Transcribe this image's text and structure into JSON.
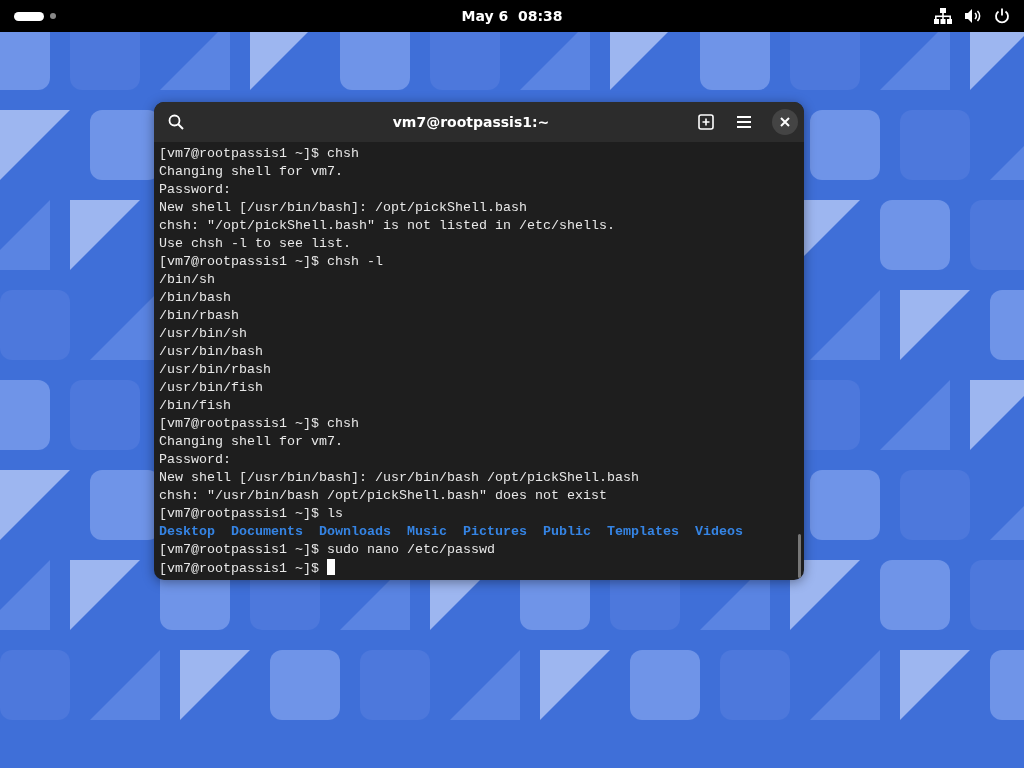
{
  "top_bar": {
    "workspaces": [
      {
        "selected": true
      },
      {
        "selected": false
      }
    ],
    "clock": "May 6  08:38"
  },
  "terminal": {
    "title": "vm7@rootpassis1:~",
    "lines": [
      {
        "kind": "text",
        "text": "[vm7@rootpassis1 ~]$ chsh"
      },
      {
        "kind": "text",
        "text": "Changing shell for vm7."
      },
      {
        "kind": "text",
        "text": "Password:"
      },
      {
        "kind": "text",
        "text": "New shell [/usr/bin/bash]: /opt/pickShell.bash"
      },
      {
        "kind": "text",
        "text": "chsh: \"/opt/pickShell.bash\" is not listed in /etc/shells."
      },
      {
        "kind": "text",
        "text": "Use chsh -l to see list."
      },
      {
        "kind": "text",
        "text": "[vm7@rootpassis1 ~]$ chsh -l"
      },
      {
        "kind": "text",
        "text": "/bin/sh"
      },
      {
        "kind": "text",
        "text": "/bin/bash"
      },
      {
        "kind": "text",
        "text": "/bin/rbash"
      },
      {
        "kind": "text",
        "text": "/usr/bin/sh"
      },
      {
        "kind": "text",
        "text": "/usr/bin/bash"
      },
      {
        "kind": "text",
        "text": "/usr/bin/rbash"
      },
      {
        "kind": "text",
        "text": "/usr/bin/fish"
      },
      {
        "kind": "text",
        "text": "/bin/fish"
      },
      {
        "kind": "text",
        "text": "[vm7@rootpassis1 ~]$ chsh"
      },
      {
        "kind": "text",
        "text": "Changing shell for vm7."
      },
      {
        "kind": "text",
        "text": "Password:"
      },
      {
        "kind": "text",
        "text": "New shell [/usr/bin/bash]: /usr/bin/bash /opt/pickShell.bash"
      },
      {
        "kind": "text",
        "text": "chsh: \"/usr/bin/bash /opt/pickShell.bash\" does not exist"
      },
      {
        "kind": "text",
        "text": "[vm7@rootpassis1 ~]$ ls"
      },
      {
        "kind": "dirs",
        "items": [
          "Desktop",
          "Documents",
          "Downloads",
          "Music",
          "Pictures",
          "Public",
          "Templates",
          "Videos"
        ]
      },
      {
        "kind": "text",
        "text": "[vm7@rootpassis1 ~]$ sudo nano /etc/passwd"
      },
      {
        "kind": "prompt",
        "text": "[vm7@rootpassis1 ~]$"
      }
    ]
  }
}
